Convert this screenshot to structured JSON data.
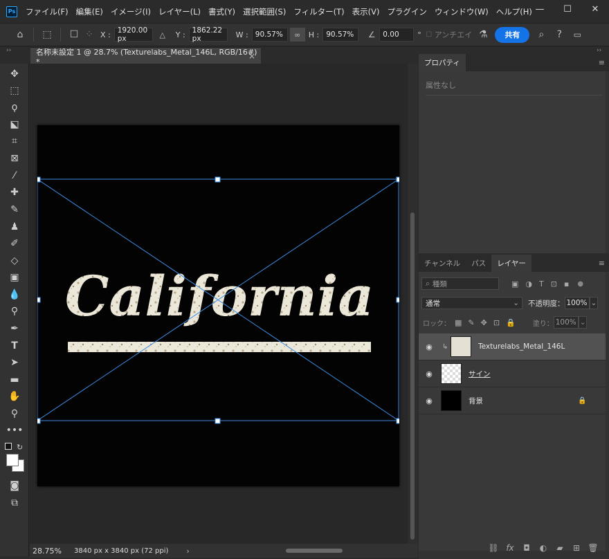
{
  "app": {
    "logo": "Ps",
    "menus": [
      "ファイル(F)",
      "編集(E)",
      "イメージ(I)",
      "レイヤー(L)",
      "書式(Y)",
      "選択範囲(S)",
      "フィルター(T)",
      "表示(V)",
      "プラグイン",
      "ウィンドウ(W)",
      "ヘルプ(H)"
    ],
    "window_controls": {
      "minimize": "—",
      "maximize": "☐",
      "close": "✕"
    }
  },
  "options": {
    "x_label": "X :",
    "x_value": "1920.00 px",
    "y_label": "Y :",
    "y_value": "1862.22 px",
    "w_label": "W :",
    "w_value": "90.57%",
    "h_label": "H :",
    "h_value": "90.57%",
    "angle_value": "0.00",
    "angle_unit": "°",
    "antialias_label": "アンチエイ",
    "share_label": "共有"
  },
  "document": {
    "tab_title": "名称未設定 1 @ 28.7% (Texturelabs_Metal_146L, RGB/16#) *",
    "close": "×",
    "artwork_text": "California"
  },
  "status": {
    "zoom": "28.75%",
    "doc_size": "3840 px x 3840 px (72 ppi)",
    "arrow": "›"
  },
  "properties": {
    "tab": "プロパティ",
    "empty": "属性なし"
  },
  "layers": {
    "tabs": [
      "チャンネル",
      "パス",
      "レイヤー"
    ],
    "filter_placeholder": "種類",
    "blend_mode": "通常",
    "opacity_label": "不透明度：",
    "opacity_value": "100%",
    "lock_label": "ロック：",
    "fill_label": "塗り：",
    "fill_value": "100%",
    "items": [
      {
        "name": "Texturelabs_Metal_146L",
        "selected": true
      },
      {
        "name": "サイン",
        "selected": false
      },
      {
        "name": "背景",
        "selected": false
      }
    ]
  },
  "colors": {
    "accent": "#1473e6",
    "transform_handle": "#3d8ee6"
  }
}
